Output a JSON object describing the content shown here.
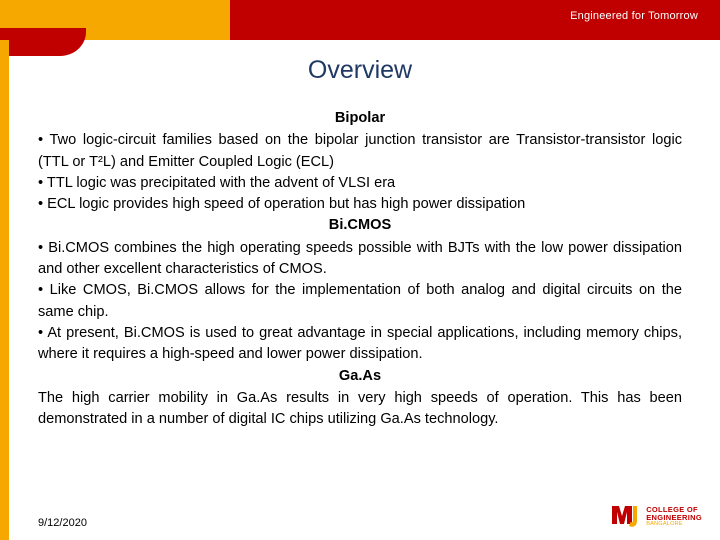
{
  "banner": {
    "tagline": "Engineered for Tomorrow"
  },
  "slide": {
    "title": "Overview",
    "sections": [
      {
        "heading": "Bipolar",
        "lines": [
          "• Two logic-circuit families based on the bipolar junction transistor are Transistor-transistor logic (TTL or T²L) and Emitter Coupled Logic (ECL)",
          "• TTL logic was precipitated with the advent of VLSI era",
          "• ECL logic provides high speed of operation but has high power dissipation"
        ]
      },
      {
        "heading": "Bi.CMOS",
        "lines": [
          "• Bi.CMOS combines the high operating speeds possible with BJTs  with the low power dissipation and other excellent characteristics of CMOS.",
          "• Like CMOS, Bi.CMOS allows for the implementation of both analog and digital circuits on the same chip.",
          "• At present, Bi.CMOS is used to great advantage in special applications, including memory chips, where it requires a high-speed and lower power dissipation."
        ]
      },
      {
        "heading": "Ga.As",
        "lines": [
          "The high carrier mobility in Ga.As results in very high speeds of operation. This has been demonstrated in a number of digital IC chips utilizing Ga.As technology."
        ]
      }
    ]
  },
  "footer": {
    "date": "9/12/2020",
    "logo": {
      "name": "MVJ",
      "line1": "COLLEGE OF",
      "line2": "ENGINEERING",
      "line3": "BANGALORE"
    }
  }
}
